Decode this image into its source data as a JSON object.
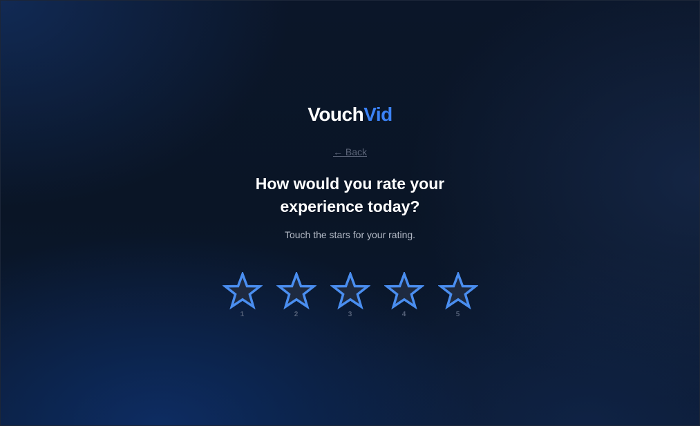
{
  "brand": {
    "name_part1": "Vouch",
    "name_part2": "Vid",
    "accent_color": "#3b82f6"
  },
  "nav": {
    "back_label": "← Back"
  },
  "prompt": {
    "question_line1": "How would you rate your",
    "question_line2": "experience today?",
    "subtitle": "Touch the stars for your rating."
  },
  "rating": {
    "max": 5,
    "selected": 0,
    "star_icon": "star-outline-icon",
    "stars": [
      {
        "label": "1"
      },
      {
        "label": "2"
      },
      {
        "label": "3"
      },
      {
        "label": "4"
      },
      {
        "label": "5"
      }
    ],
    "star_stroke_color": "#4a8ef0",
    "star_fill_color": "#1e2a40"
  }
}
